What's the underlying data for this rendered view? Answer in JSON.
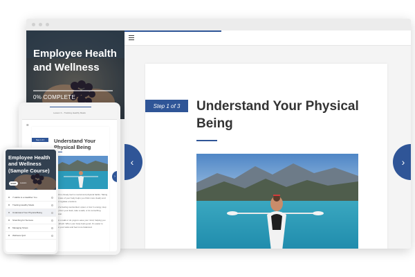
{
  "colors": {
    "accent": "#2f5597"
  },
  "course": {
    "title": "Employee Health and Wellness",
    "progress_text": "0% COMPLETE",
    "progress_fraction": 0
  },
  "lesson": {
    "step_label": "Step 1 of 3",
    "title": "Understand Your Physical Being"
  },
  "navigation": {
    "prev_icon": "chevron-left-icon",
    "next_icon": "chevron-right-icon",
    "menu_icon": "hamburger-menu-icon"
  },
  "tablet": {
    "header_text": "Lesson 3 – Tracking Healthy Meals",
    "step_label": "Step 1 of 3",
    "lesson_title": "Understand Your Physical Being",
    "body_paragraphs": [
      "Health is closely tied to mental and physical habits. Taking good care of your body helps you think more clearly and better regulate emotions.",
      "If you're feeling overworked, upset, or low in energy, step away from your desk, take a walk, or do something physical.",
      "Go for a walk or do yoga to ease your mind, helping you start afresh. When your body feels good, it's easier to tackle your tasks and feel more balanced."
    ]
  },
  "phone": {
    "course_title": "Employee Health and Wellness (Sample Course)",
    "start_label": "START",
    "section_label": "Lessons",
    "lessons": [
      {
        "label": "7 Habits to a Healthier You",
        "active": false
      },
      {
        "label": "Tracking Healthy Meals",
        "active": false
      },
      {
        "label": "Understand Your Physical Being",
        "active": true
      },
      {
        "label": "Stretching for Success",
        "active": false
      },
      {
        "label": "Managing Stress",
        "active": false
      },
      {
        "label": "Wellness Quiz",
        "active": false
      }
    ]
  }
}
